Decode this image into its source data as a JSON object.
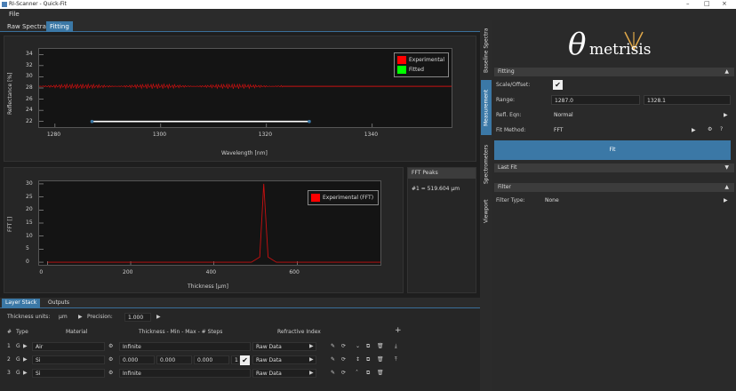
{
  "window": {
    "title": "RI-Scanner - Quick-Fit",
    "controls": [
      "–",
      "□",
      "×"
    ]
  },
  "menu": {
    "file": "File"
  },
  "tabs": [
    {
      "label": "Raw Spectra"
    },
    {
      "label": "Fitting"
    }
  ],
  "plot1": {
    "legend": [
      {
        "label": "Experimental",
        "color": "#ff0000"
      },
      {
        "label": "Fitted",
        "color": "#00ff00"
      }
    ]
  },
  "plot2": {
    "panel_label": "FFT Peaks",
    "peak_text": "#1 = 519.604 µm",
    "legend": [
      {
        "label": "Experimental (FFT)",
        "color": "#ff0000"
      }
    ]
  },
  "chart_data": [
    {
      "type": "line",
      "xlabel": "Wavelength [nm]",
      "ylabel": "Reflectance [%]",
      "xlim": [
        1277,
        1355
      ],
      "ylim": [
        21,
        35
      ],
      "xticks": [
        1280,
        1300,
        1320,
        1340
      ],
      "yticks": [
        22,
        24,
        26,
        28,
        30,
        32,
        34
      ],
      "series": [
        {
          "name": "Experimental",
          "color": "#c81010",
          "x": [
            1277,
            1355
          ],
          "y": [
            28.3,
            28.3
          ],
          "noisy_until": 1323
        }
      ],
      "range_line": [
        1287.0,
        1328.1
      ]
    },
    {
      "type": "line",
      "xlabel": "Thickness [µm]",
      "ylabel": "FFT []",
      "xlim": [
        -20,
        800
      ],
      "ylim": [
        -1,
        31
      ],
      "xticks": [
        0,
        200,
        400,
        600
      ],
      "yticks": [
        0,
        5,
        10,
        15,
        20,
        25,
        30
      ],
      "series": [
        {
          "name": "Experimental (FFT)",
          "color": "#c81010",
          "x": [
            0,
            490,
            510,
            519.6,
            530,
            550,
            800
          ],
          "y": [
            0,
            0,
            2,
            30,
            2,
            0,
            0
          ]
        }
      ]
    }
  ],
  "vertical_tabs": [
    "Baseline Spectra",
    "Measurement",
    "Spectrometers",
    "Viewport"
  ],
  "logo": {
    "theta": "θ",
    "text": "metrisis"
  },
  "fitting": {
    "header": "Fitting",
    "scale_offset_label": "Scale/Offset:",
    "range_label": "Range:",
    "range_min": "1287.0",
    "range_max": "1328.1",
    "refl_eq_label": "Refl. Eqn:",
    "refl_eq_value": "Normal",
    "fit_method_label": "Fit Method:",
    "fit_method_value": "FFT",
    "fit_button": "Fit"
  },
  "last_fit": {
    "header": "Last Fit"
  },
  "filter": {
    "header": "Filter",
    "type_label": "Filter Type:",
    "type_value": "None"
  },
  "bottom": {
    "tabs": [
      "Layer Stack",
      "Outputs"
    ],
    "units_label": "Thickness units:",
    "units_value": "µm",
    "precision_label": "Precision:",
    "precision_value": "1.000",
    "headers": {
      "num": "#",
      "type": "Type",
      "material": "Material",
      "thickness": "Thickness - Min - Max - # Steps",
      "ri": "Refractive Index"
    },
    "rows": [
      {
        "num": "1",
        "type": "G",
        "material": "Air",
        "thickness": "Infinite",
        "min": "",
        "max": "",
        "steps": "",
        "ri": "Raw Data"
      },
      {
        "num": "2",
        "type": "G",
        "material": "Si",
        "thickness": "0.000",
        "min": "0.000",
        "max": "0.000",
        "steps": "1",
        "ri": "Raw Data"
      },
      {
        "num": "3",
        "type": "G",
        "material": "Si",
        "thickness": "Infinite",
        "min": "",
        "max": "",
        "steps": "",
        "ri": "Raw Data"
      }
    ]
  }
}
